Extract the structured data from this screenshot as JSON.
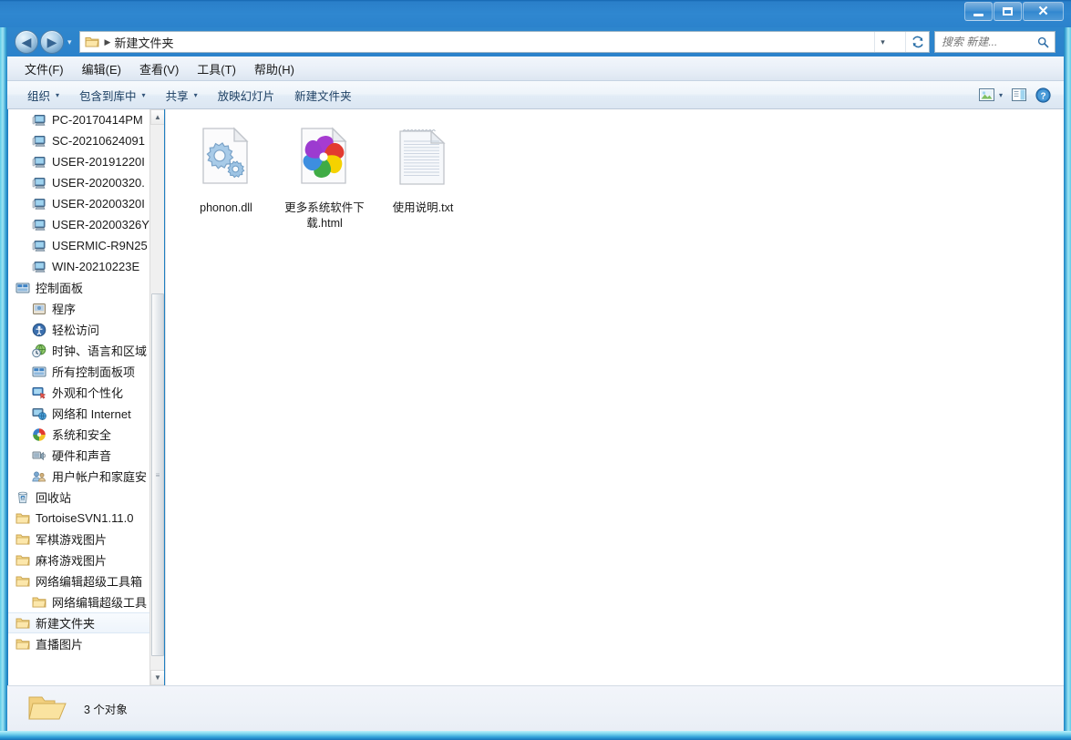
{
  "window": {
    "title": "",
    "buttons": {
      "minimize": "minimize-button",
      "maximize": "maximize-button",
      "close": "close-button"
    }
  },
  "address_bar": {
    "back_glyph": "◀",
    "forward_glyph": "▶",
    "recent_caret": "▾",
    "folder_icon": "folder-icon",
    "separator": "▶",
    "path": "新建文件夹",
    "dropdown_caret": "▾",
    "refresh_glyph": "↻"
  },
  "search": {
    "placeholder": "搜索 新建...",
    "value": "",
    "icon": "search-icon"
  },
  "menu": {
    "items": [
      {
        "label": "文件(F)"
      },
      {
        "label": "编辑(E)"
      },
      {
        "label": "查看(V)"
      },
      {
        "label": "工具(T)"
      },
      {
        "label": "帮助(H)"
      }
    ]
  },
  "toolbar": {
    "items": [
      {
        "label": "组织",
        "caret": "▾"
      },
      {
        "label": "包含到库中",
        "caret": "▾"
      },
      {
        "label": "共享",
        "caret": "▾"
      },
      {
        "label": "放映幻灯片",
        "caret": ""
      },
      {
        "label": "新建文件夹",
        "caret": ""
      }
    ],
    "right_icons": [
      {
        "name": "view-layout-icon",
        "caret": "▾"
      },
      {
        "name": "preview-pane-icon",
        "caret": ""
      },
      {
        "name": "help-icon",
        "caret": ""
      }
    ]
  },
  "nav_pane": {
    "items": [
      {
        "label": "PC-20170414PM",
        "icon": "computer-icon",
        "indent": 1,
        "selected": false
      },
      {
        "label": "SC-20210624091",
        "icon": "computer-icon",
        "indent": 1,
        "selected": false
      },
      {
        "label": "USER-20191220I",
        "icon": "computer-icon",
        "indent": 1,
        "selected": false
      },
      {
        "label": "USER-20200320.",
        "icon": "computer-icon",
        "indent": 1,
        "selected": false
      },
      {
        "label": "USER-20200320I",
        "icon": "computer-icon",
        "indent": 1,
        "selected": false
      },
      {
        "label": "USER-20200326Y",
        "icon": "computer-icon",
        "indent": 1,
        "selected": false
      },
      {
        "label": "USERMIC-R9N25",
        "icon": "computer-icon",
        "indent": 1,
        "selected": false
      },
      {
        "label": "WIN-20210223E",
        "icon": "computer-icon",
        "indent": 1,
        "selected": false
      },
      {
        "label": "控制面板",
        "icon": "control-panel-icon",
        "indent": 0,
        "selected": false
      },
      {
        "label": "程序",
        "icon": "programs-icon",
        "indent": 1,
        "selected": false
      },
      {
        "label": "轻松访问",
        "icon": "ease-of-access-icon",
        "indent": 1,
        "selected": false
      },
      {
        "label": "时钟、语言和区域",
        "icon": "clock-language-icon",
        "indent": 1,
        "selected": false
      },
      {
        "label": "所有控制面板项",
        "icon": "all-items-icon",
        "indent": 1,
        "selected": false
      },
      {
        "label": "外观和个性化",
        "icon": "appearance-icon",
        "indent": 1,
        "selected": false
      },
      {
        "label": "网络和 Internet",
        "icon": "network-internet-icon",
        "indent": 1,
        "selected": false
      },
      {
        "label": "系统和安全",
        "icon": "system-security-icon",
        "indent": 1,
        "selected": false
      },
      {
        "label": "硬件和声音",
        "icon": "hardware-sound-icon",
        "indent": 1,
        "selected": false
      },
      {
        "label": "用户帐户和家庭安",
        "icon": "user-accounts-icon",
        "indent": 1,
        "selected": false
      },
      {
        "label": "回收站",
        "icon": "recycle-bin-icon",
        "indent": 0,
        "selected": false
      },
      {
        "label": "TortoiseSVN1.11.0",
        "icon": "folder-icon",
        "indent": 0,
        "selected": false
      },
      {
        "label": "军棋游戏图片",
        "icon": "folder-icon",
        "indent": 0,
        "selected": false
      },
      {
        "label": "麻将游戏图片",
        "icon": "folder-icon",
        "indent": 0,
        "selected": false
      },
      {
        "label": "网络编辑超级工具箱",
        "icon": "folder-icon",
        "indent": 0,
        "selected": false
      },
      {
        "label": "网络编辑超级工具",
        "icon": "folder-icon",
        "indent": 1,
        "selected": false
      },
      {
        "label": "新建文件夹",
        "icon": "folder-icon",
        "indent": 0,
        "selected": true
      },
      {
        "label": "直播图片",
        "icon": "folder-icon",
        "indent": 0,
        "selected": false
      }
    ],
    "scrollbar": {
      "up_glyph": "▲",
      "down_glyph": "▼",
      "thumb_grip": "≡"
    }
  },
  "files": [
    {
      "name": "phonon.dll",
      "icon": "dll-gears-icon"
    },
    {
      "name": "更多系统软件下载.html",
      "icon": "html-pinwheel-icon"
    },
    {
      "name": "使用说明.txt",
      "icon": "text-notepad-icon"
    }
  ],
  "status_bar": {
    "icon": "folder-open-icon",
    "text": "3 个对象"
  },
  "colors": {
    "titlebar_blue": "#2f87d0",
    "frame_cyan": "#5fcbe8",
    "selection": "#eef4fb",
    "content_bg": "#ffffff",
    "toolbar_text": "#1c3f63"
  }
}
